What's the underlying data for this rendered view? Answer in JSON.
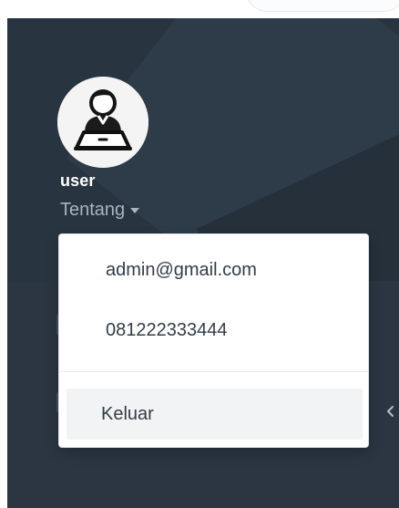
{
  "user": {
    "name": "user",
    "about_label": "Tentang"
  },
  "dropdown": {
    "email": "admin@gmail.com",
    "phone": "081222333444",
    "logout_label": "Keluar"
  },
  "icons": {
    "avatar": "user-at-laptop-icon",
    "caret": "caret-down-icon",
    "chevron": "chevron-left-icon"
  },
  "colors": {
    "sidebar_background": "#2b3642",
    "header_background": "#283540",
    "username_text": "#ffffff",
    "muted_text": "#aab4bf",
    "dropdown_background": "#ffffff",
    "dropdown_text": "#333d47",
    "hover_background": "#f2f3f5"
  }
}
